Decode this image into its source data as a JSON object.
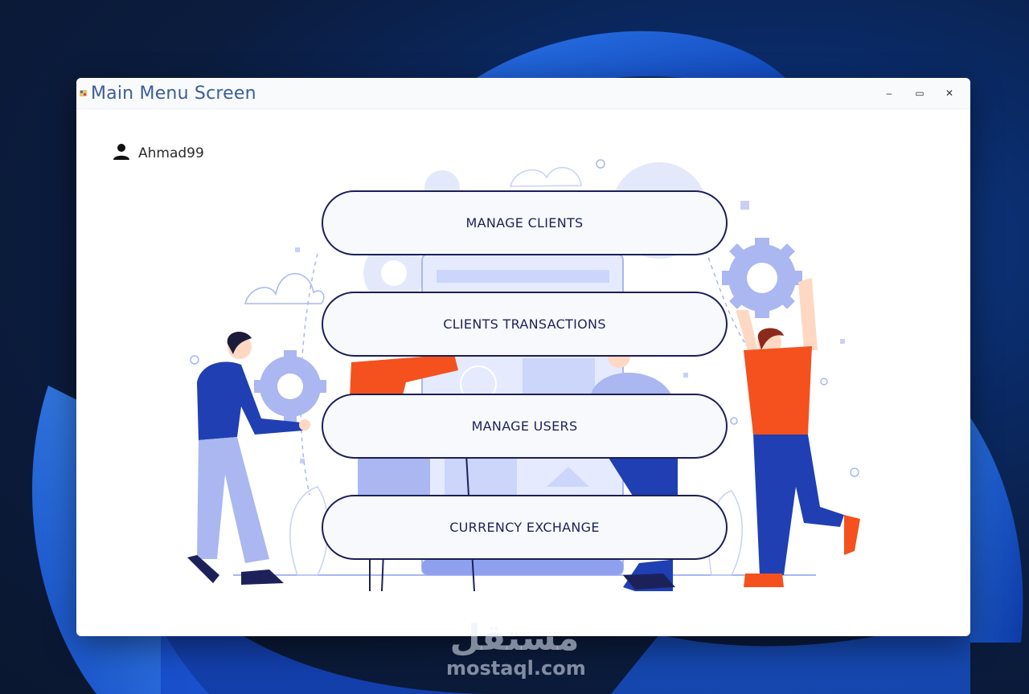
{
  "window": {
    "title": "Main Menu Screen",
    "controls": {
      "minimize": "–",
      "maximize": "▭",
      "close": "✕"
    }
  },
  "user": {
    "name": "Ahmad99",
    "icon": "user-icon"
  },
  "menu": {
    "manage_clients": "MANAGE CLIENTS",
    "clients_transactions": "CLIENTS TRANSACTIONS",
    "manage_users": "MANAGE USERS",
    "currency_exchange": "CURRENCY EXCHANGE"
  },
  "watermark": {
    "logo": "مستقل",
    "url": "mostaql.com"
  },
  "colors": {
    "button_border": "#1b1f57",
    "button_text": "#1c2259",
    "title_text": "#3b5d9b",
    "illustration_light": "#aab7f0",
    "illustration_blue": "#1f3fb3",
    "illustration_orange": "#f4511e"
  }
}
